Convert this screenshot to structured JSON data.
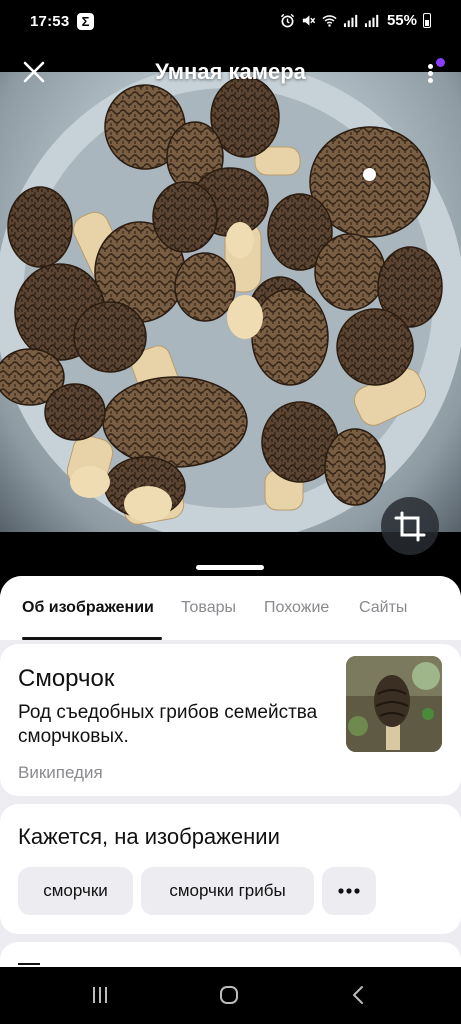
{
  "status_bar": {
    "time": "17:53",
    "app_icon_glyph": "Σ",
    "icons": [
      "alarm-icon",
      "mute-icon",
      "wifi-icon",
      "signal-icon",
      "signal-icon"
    ],
    "battery": "55%"
  },
  "header": {
    "title": "Умная камера",
    "close_icon": "close-icon",
    "menu_icon": "more-vertical-icon",
    "notification_color": "#8b3dff"
  },
  "image": {
    "subject": "photo-of-morel-mushrooms"
  },
  "crop_icon": "crop-icon",
  "tabs": [
    {
      "label": "Об изображении",
      "active": true
    },
    {
      "label": "Товары",
      "active": false
    },
    {
      "label": "Похожие",
      "active": false
    },
    {
      "label": "Сайты",
      "active": false
    }
  ],
  "wiki": {
    "title": "Сморчок",
    "description": "Род съедобных грибов семейства сморчковых.",
    "source": "Википедия"
  },
  "seems": {
    "title": "Кажется, на изображении",
    "chips": [
      "сморчки",
      "сморчки грибы"
    ],
    "more_icon": "more-horizontal-icon"
  },
  "nav": {
    "icons": [
      "recents-icon",
      "home-icon",
      "back-icon"
    ]
  }
}
